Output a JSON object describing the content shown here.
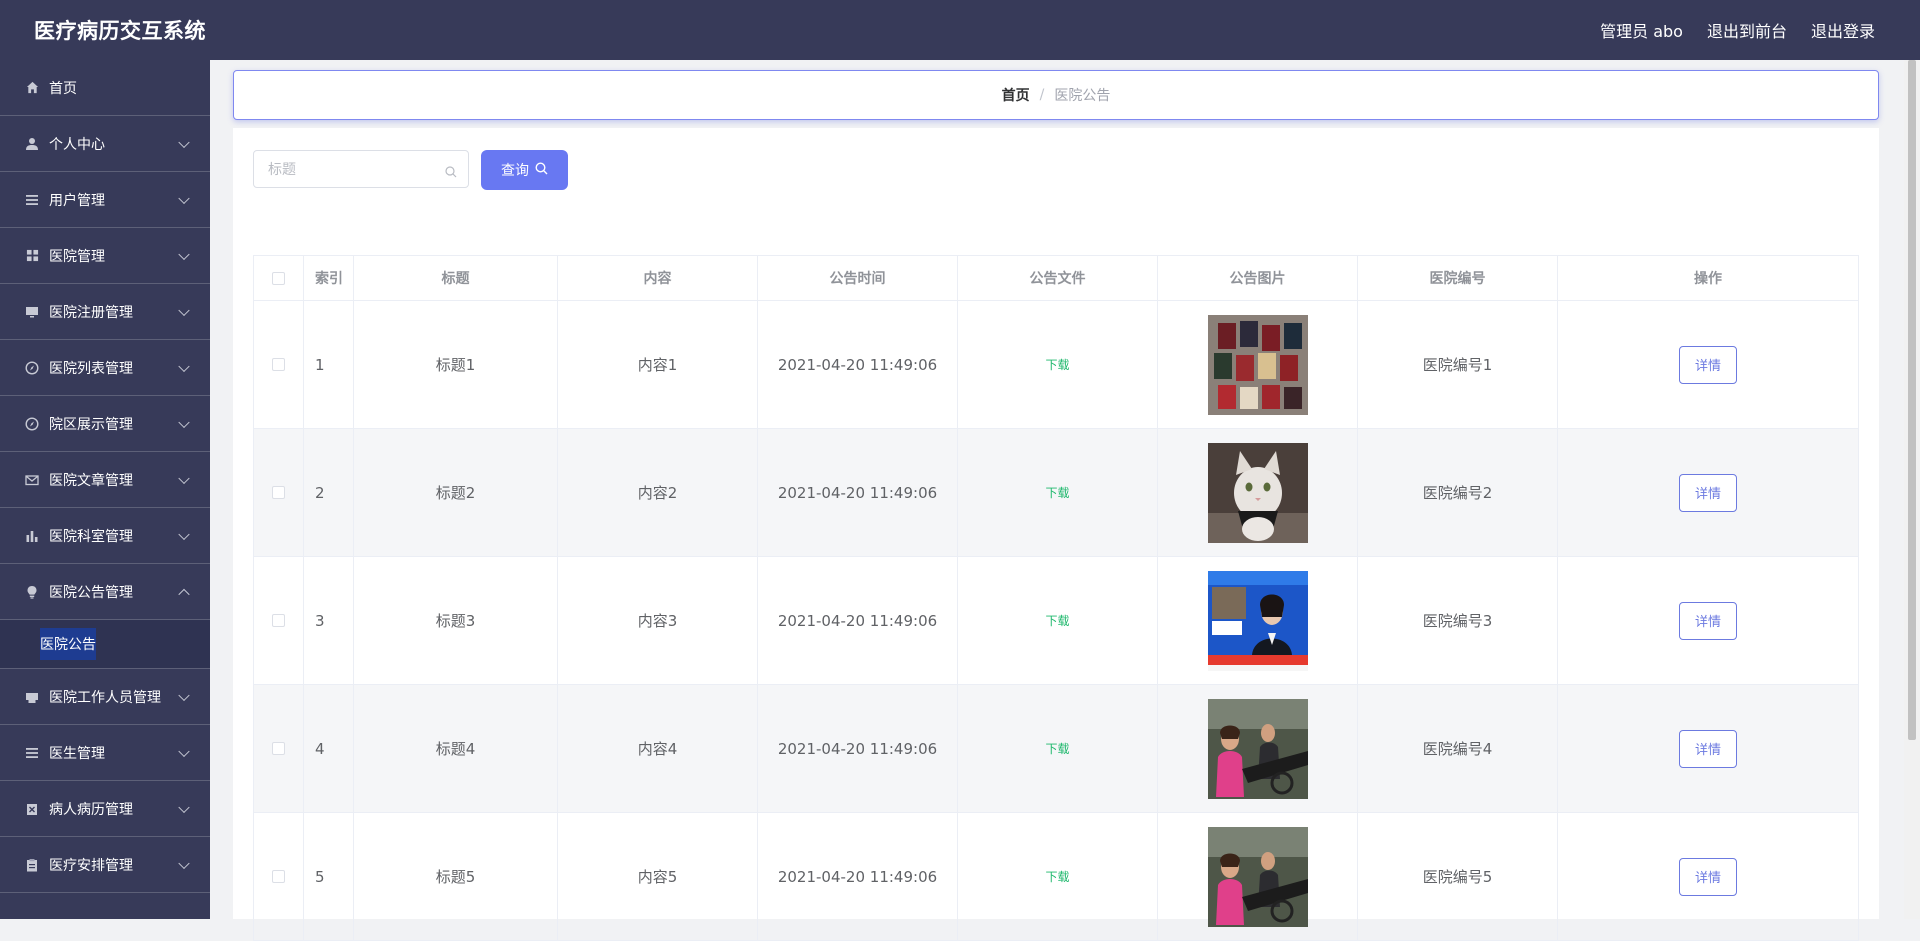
{
  "header": {
    "title": "医疗病历交互系统",
    "user_label": "管理员 abo",
    "front_link": "退出到前台",
    "logout_link": "退出登录"
  },
  "sidebar": {
    "items": [
      {
        "label": "首页",
        "icon": "home-icon"
      },
      {
        "label": "个人中心",
        "icon": "user-icon"
      },
      {
        "label": "用户管理",
        "icon": "list-icon"
      },
      {
        "label": "医院管理",
        "icon": "grid-icon"
      },
      {
        "label": "医院注册管理",
        "icon": "monitor-icon"
      },
      {
        "label": "医院列表管理",
        "icon": "compass-icon"
      },
      {
        "label": "院区展示管理",
        "icon": "compass-icon"
      },
      {
        "label": "医院文章管理",
        "icon": "mail-icon"
      },
      {
        "label": "医院科室管理",
        "icon": "bar-chart-icon"
      },
      {
        "label": "医院公告管理",
        "icon": "bulb-icon",
        "expanded": true
      },
      {
        "label": "医院工作人员管理",
        "icon": "printer-icon"
      },
      {
        "label": "医生管理",
        "icon": "list-icon"
      },
      {
        "label": "病人病历管理",
        "icon": "delete-icon"
      },
      {
        "label": "医疗安排管理",
        "icon": "clipboard-icon"
      }
    ],
    "submenu_label": "医院公告"
  },
  "breadcrumb": {
    "home": "首页",
    "separator": "/",
    "current": "医院公告"
  },
  "search": {
    "placeholder": "标题",
    "value": "",
    "button_label": "查询"
  },
  "table": {
    "headers": {
      "index": "索引",
      "title": "标题",
      "content": "内容",
      "time": "公告时间",
      "file": "公告文件",
      "image": "公告图片",
      "hospital_no": "医院编号",
      "action": "操作"
    },
    "rows": [
      {
        "index": "1",
        "title": "标题1",
        "content": "内容1",
        "time": "2021-04-20 11:49:06",
        "file": "下载",
        "image": "certificates-photo",
        "hospital_no": "医院编号1",
        "action": "详情"
      },
      {
        "index": "2",
        "title": "标题2",
        "content": "内容2",
        "time": "2021-04-20 11:49:06",
        "file": "下载",
        "image": "cat-photo",
        "hospital_no": "医院编号2",
        "action": "详情"
      },
      {
        "index": "3",
        "title": "标题3",
        "content": "内容3",
        "time": "2021-04-20 11:49:06",
        "file": "下载",
        "image": "news-anchor-photo",
        "hospital_no": "医院编号3",
        "action": "详情"
      },
      {
        "index": "4",
        "title": "标题4",
        "content": "内容4",
        "time": "2021-04-20 11:49:06",
        "file": "下载",
        "image": "gym-photo",
        "hospital_no": "医院编号4",
        "action": "详情"
      },
      {
        "index": "5",
        "title": "标题5",
        "content": "内容5",
        "time": "2021-04-20 11:49:06",
        "file": "下载",
        "image": "gym-photo",
        "hospital_no": "医院编号5",
        "action": "详情"
      }
    ]
  },
  "colors": {
    "topbar_bg": "#373a59",
    "sidebar_bg": "#373a59",
    "accent": "#6878f2",
    "download_green": "#1fb86d",
    "active_highlight": "#1e3c91"
  }
}
